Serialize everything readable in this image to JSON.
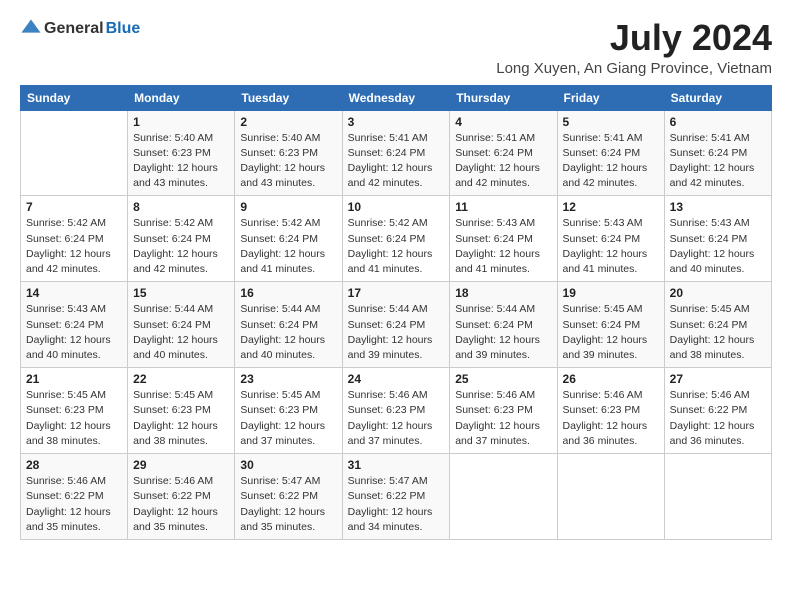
{
  "logo": {
    "general": "General",
    "blue": "Blue"
  },
  "header": {
    "title": "July 2024",
    "subtitle": "Long Xuyen, An Giang Province, Vietnam"
  },
  "weekdays": [
    "Sunday",
    "Monday",
    "Tuesday",
    "Wednesday",
    "Thursday",
    "Friday",
    "Saturday"
  ],
  "weeks": [
    [
      {
        "day": "",
        "info": ""
      },
      {
        "day": "1",
        "info": "Sunrise: 5:40 AM\nSunset: 6:23 PM\nDaylight: 12 hours\nand 43 minutes."
      },
      {
        "day": "2",
        "info": "Sunrise: 5:40 AM\nSunset: 6:23 PM\nDaylight: 12 hours\nand 43 minutes."
      },
      {
        "day": "3",
        "info": "Sunrise: 5:41 AM\nSunset: 6:24 PM\nDaylight: 12 hours\nand 42 minutes."
      },
      {
        "day": "4",
        "info": "Sunrise: 5:41 AM\nSunset: 6:24 PM\nDaylight: 12 hours\nand 42 minutes."
      },
      {
        "day": "5",
        "info": "Sunrise: 5:41 AM\nSunset: 6:24 PM\nDaylight: 12 hours\nand 42 minutes."
      },
      {
        "day": "6",
        "info": "Sunrise: 5:41 AM\nSunset: 6:24 PM\nDaylight: 12 hours\nand 42 minutes."
      }
    ],
    [
      {
        "day": "7",
        "info": "Sunrise: 5:42 AM\nSunset: 6:24 PM\nDaylight: 12 hours\nand 42 minutes."
      },
      {
        "day": "8",
        "info": "Sunrise: 5:42 AM\nSunset: 6:24 PM\nDaylight: 12 hours\nand 42 minutes."
      },
      {
        "day": "9",
        "info": "Sunrise: 5:42 AM\nSunset: 6:24 PM\nDaylight: 12 hours\nand 41 minutes."
      },
      {
        "day": "10",
        "info": "Sunrise: 5:42 AM\nSunset: 6:24 PM\nDaylight: 12 hours\nand 41 minutes."
      },
      {
        "day": "11",
        "info": "Sunrise: 5:43 AM\nSunset: 6:24 PM\nDaylight: 12 hours\nand 41 minutes."
      },
      {
        "day": "12",
        "info": "Sunrise: 5:43 AM\nSunset: 6:24 PM\nDaylight: 12 hours\nand 41 minutes."
      },
      {
        "day": "13",
        "info": "Sunrise: 5:43 AM\nSunset: 6:24 PM\nDaylight: 12 hours\nand 40 minutes."
      }
    ],
    [
      {
        "day": "14",
        "info": "Sunrise: 5:43 AM\nSunset: 6:24 PM\nDaylight: 12 hours\nand 40 minutes."
      },
      {
        "day": "15",
        "info": "Sunrise: 5:44 AM\nSunset: 6:24 PM\nDaylight: 12 hours\nand 40 minutes."
      },
      {
        "day": "16",
        "info": "Sunrise: 5:44 AM\nSunset: 6:24 PM\nDaylight: 12 hours\nand 40 minutes."
      },
      {
        "day": "17",
        "info": "Sunrise: 5:44 AM\nSunset: 6:24 PM\nDaylight: 12 hours\nand 39 minutes."
      },
      {
        "day": "18",
        "info": "Sunrise: 5:44 AM\nSunset: 6:24 PM\nDaylight: 12 hours\nand 39 minutes."
      },
      {
        "day": "19",
        "info": "Sunrise: 5:45 AM\nSunset: 6:24 PM\nDaylight: 12 hours\nand 39 minutes."
      },
      {
        "day": "20",
        "info": "Sunrise: 5:45 AM\nSunset: 6:24 PM\nDaylight: 12 hours\nand 38 minutes."
      }
    ],
    [
      {
        "day": "21",
        "info": "Sunrise: 5:45 AM\nSunset: 6:23 PM\nDaylight: 12 hours\nand 38 minutes."
      },
      {
        "day": "22",
        "info": "Sunrise: 5:45 AM\nSunset: 6:23 PM\nDaylight: 12 hours\nand 38 minutes."
      },
      {
        "day": "23",
        "info": "Sunrise: 5:45 AM\nSunset: 6:23 PM\nDaylight: 12 hours\nand 37 minutes."
      },
      {
        "day": "24",
        "info": "Sunrise: 5:46 AM\nSunset: 6:23 PM\nDaylight: 12 hours\nand 37 minutes."
      },
      {
        "day": "25",
        "info": "Sunrise: 5:46 AM\nSunset: 6:23 PM\nDaylight: 12 hours\nand 37 minutes."
      },
      {
        "day": "26",
        "info": "Sunrise: 5:46 AM\nSunset: 6:23 PM\nDaylight: 12 hours\nand 36 minutes."
      },
      {
        "day": "27",
        "info": "Sunrise: 5:46 AM\nSunset: 6:22 PM\nDaylight: 12 hours\nand 36 minutes."
      }
    ],
    [
      {
        "day": "28",
        "info": "Sunrise: 5:46 AM\nSunset: 6:22 PM\nDaylight: 12 hours\nand 35 minutes."
      },
      {
        "day": "29",
        "info": "Sunrise: 5:46 AM\nSunset: 6:22 PM\nDaylight: 12 hours\nand 35 minutes."
      },
      {
        "day": "30",
        "info": "Sunrise: 5:47 AM\nSunset: 6:22 PM\nDaylight: 12 hours\nand 35 minutes."
      },
      {
        "day": "31",
        "info": "Sunrise: 5:47 AM\nSunset: 6:22 PM\nDaylight: 12 hours\nand 34 minutes."
      },
      {
        "day": "",
        "info": ""
      },
      {
        "day": "",
        "info": ""
      },
      {
        "day": "",
        "info": ""
      }
    ]
  ]
}
